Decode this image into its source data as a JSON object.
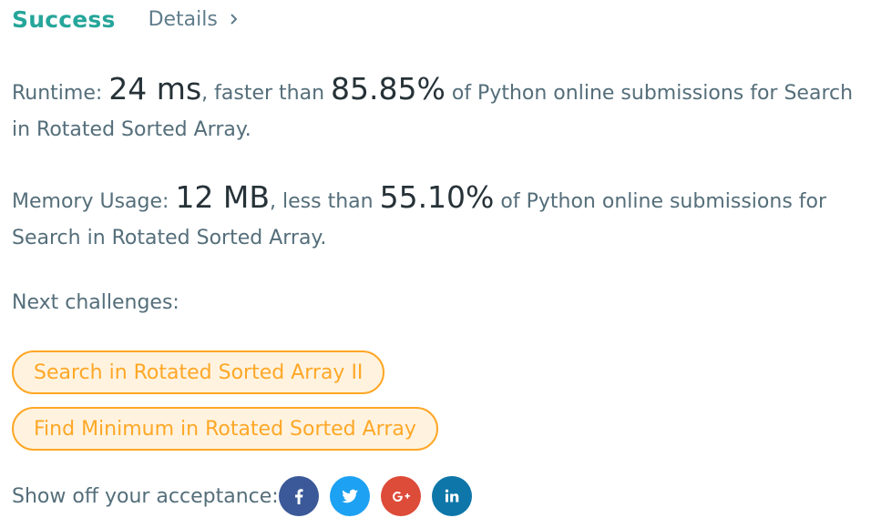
{
  "header": {
    "status": "Success",
    "details_label": "Details"
  },
  "runtime": {
    "label": "Runtime:",
    "value": "24 ms",
    "comparison": ", faster than",
    "percent": "85.85%",
    "suffix": "of Python online submissions for Search in Rotated Sorted Array."
  },
  "memory": {
    "label": "Memory Usage:",
    "value": "12 MB",
    "comparison": ", less than",
    "percent": "55.10%",
    "suffix": "of Python online submissions for Search in Rotated Sorted Array."
  },
  "next": {
    "label": "Next challenges:",
    "challenges": [
      "Search in Rotated Sorted Array II",
      "Find Minimum in Rotated Sorted Array"
    ]
  },
  "share": {
    "label": "Show off your acceptance:",
    "buttons": [
      {
        "icon": "facebook-icon",
        "color": "#3b5998"
      },
      {
        "icon": "twitter-icon",
        "color": "#1da1f2"
      },
      {
        "icon": "google-plus-icon",
        "color": "#dd4b39"
      },
      {
        "icon": "linkedin-icon",
        "color": "#0e76a8"
      }
    ]
  },
  "colors": {
    "success": "#26a69a",
    "accent": "#ffa726",
    "chip_bg": "#fff3e0"
  }
}
